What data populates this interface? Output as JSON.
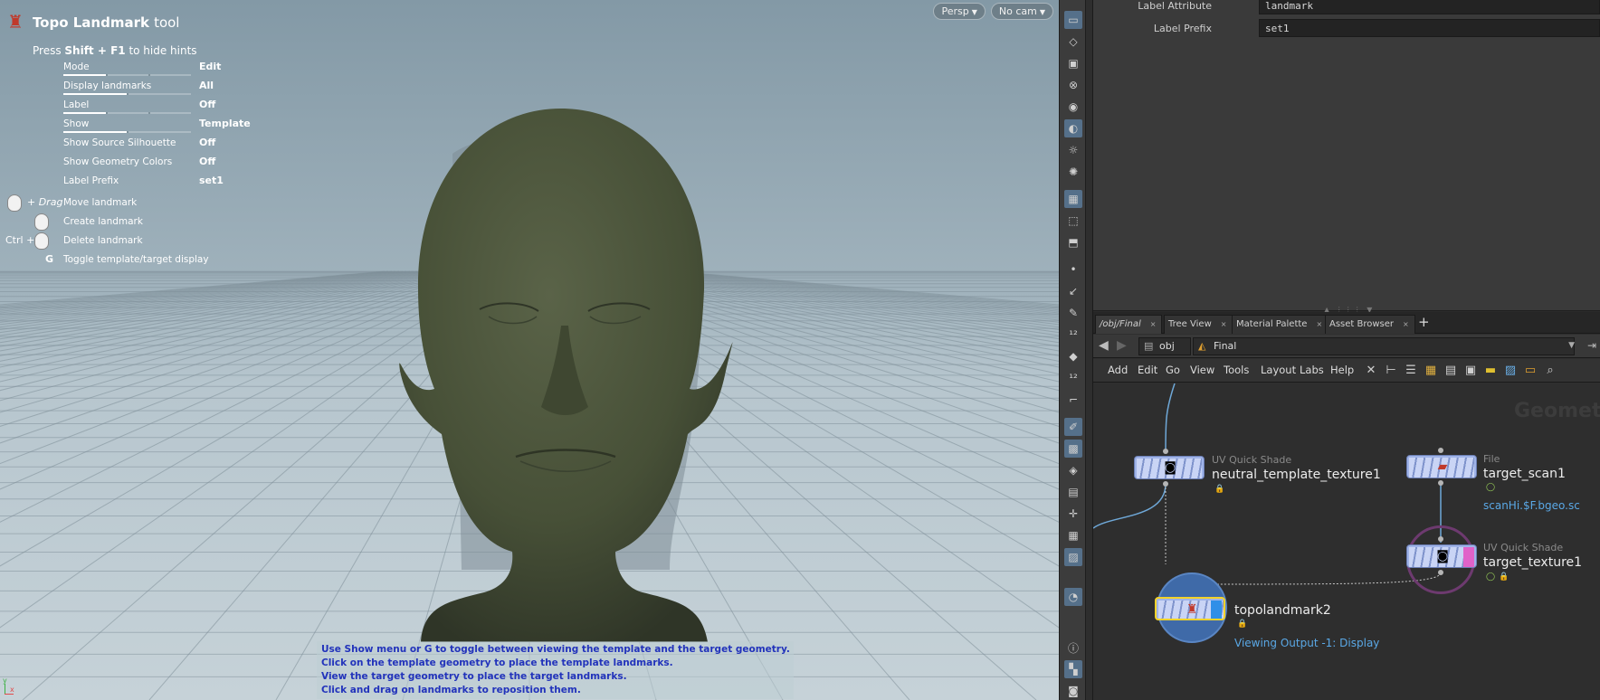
{
  "viewport": {
    "tool_title": "Topo Landmark",
    "tool_title_suffix": "tool",
    "hint_prefix": "Press ",
    "hint_keys": "Shift + F1",
    "hint_suffix": " to hide hints",
    "hud_params": [
      {
        "label": "Mode",
        "value": "Edit"
      },
      {
        "label": "Display landmarks",
        "value": "All"
      },
      {
        "label": "Label",
        "value": "Off"
      },
      {
        "label": "Show",
        "value": "Template"
      },
      {
        "label": "Show Source Silhouette",
        "value": "Off"
      },
      {
        "label": "Show Geometry Colors",
        "value": "Off"
      },
      {
        "label": "Label Prefix",
        "value": "set1"
      }
    ],
    "mouse_hints": [
      {
        "modifier": "+ Drag",
        "key": "",
        "text": "Move landmark"
      },
      {
        "modifier": "",
        "key": "",
        "text": "Create landmark"
      },
      {
        "modifier": "Ctrl +",
        "key": "",
        "text": "Delete landmark"
      },
      {
        "modifier": "",
        "key": "G",
        "text": "Toggle template/target display"
      }
    ],
    "camera_buttons": {
      "persp": "Persp",
      "cam": "No cam"
    },
    "info_lines": [
      "Use Show menu or G to toggle between viewing the template and the target geometry.",
      "Click on the template geometry to place the template landmarks.",
      "View the target geometry to place the target landmarks.",
      "Click and drag on landmarks to reposition them."
    ],
    "axis_labels": {
      "y": "y",
      "x": "x"
    }
  },
  "parameters": {
    "label_attribute": {
      "label": "Label Attribute",
      "value": "landmark"
    },
    "label_prefix": {
      "label": "Label Prefix",
      "value": "set1"
    }
  },
  "network": {
    "tabs": [
      {
        "label": "/obj/Final",
        "active": true
      },
      {
        "label": "Tree View"
      },
      {
        "label": "Material Palette"
      },
      {
        "label": "Asset Browser"
      }
    ],
    "path": {
      "root": "obj",
      "current": "Final"
    },
    "menu": [
      "Add",
      "Edit",
      "Go",
      "View",
      "Tools",
      "Layout",
      "Labs",
      "Help"
    ],
    "watermark": "Geometr",
    "nodes": {
      "neutral": {
        "type": "UV Quick Shade",
        "name": "neutral_template_texture1"
      },
      "scan": {
        "type": "File",
        "name": "target_scan1",
        "subtitle": "scanHi.$F.bgeo.sc"
      },
      "target_tex": {
        "type": "UV Quick Shade",
        "name": "target_texture1"
      },
      "topo": {
        "name": "topolandmark2",
        "subtitle": "Viewing Output -1: Display"
      }
    }
  },
  "colors": {
    "accent_blue": "#5aa8e6",
    "info_text": "#2233bb",
    "selected_node": "#f3d32a",
    "node_body": "#9fb3e8"
  }
}
